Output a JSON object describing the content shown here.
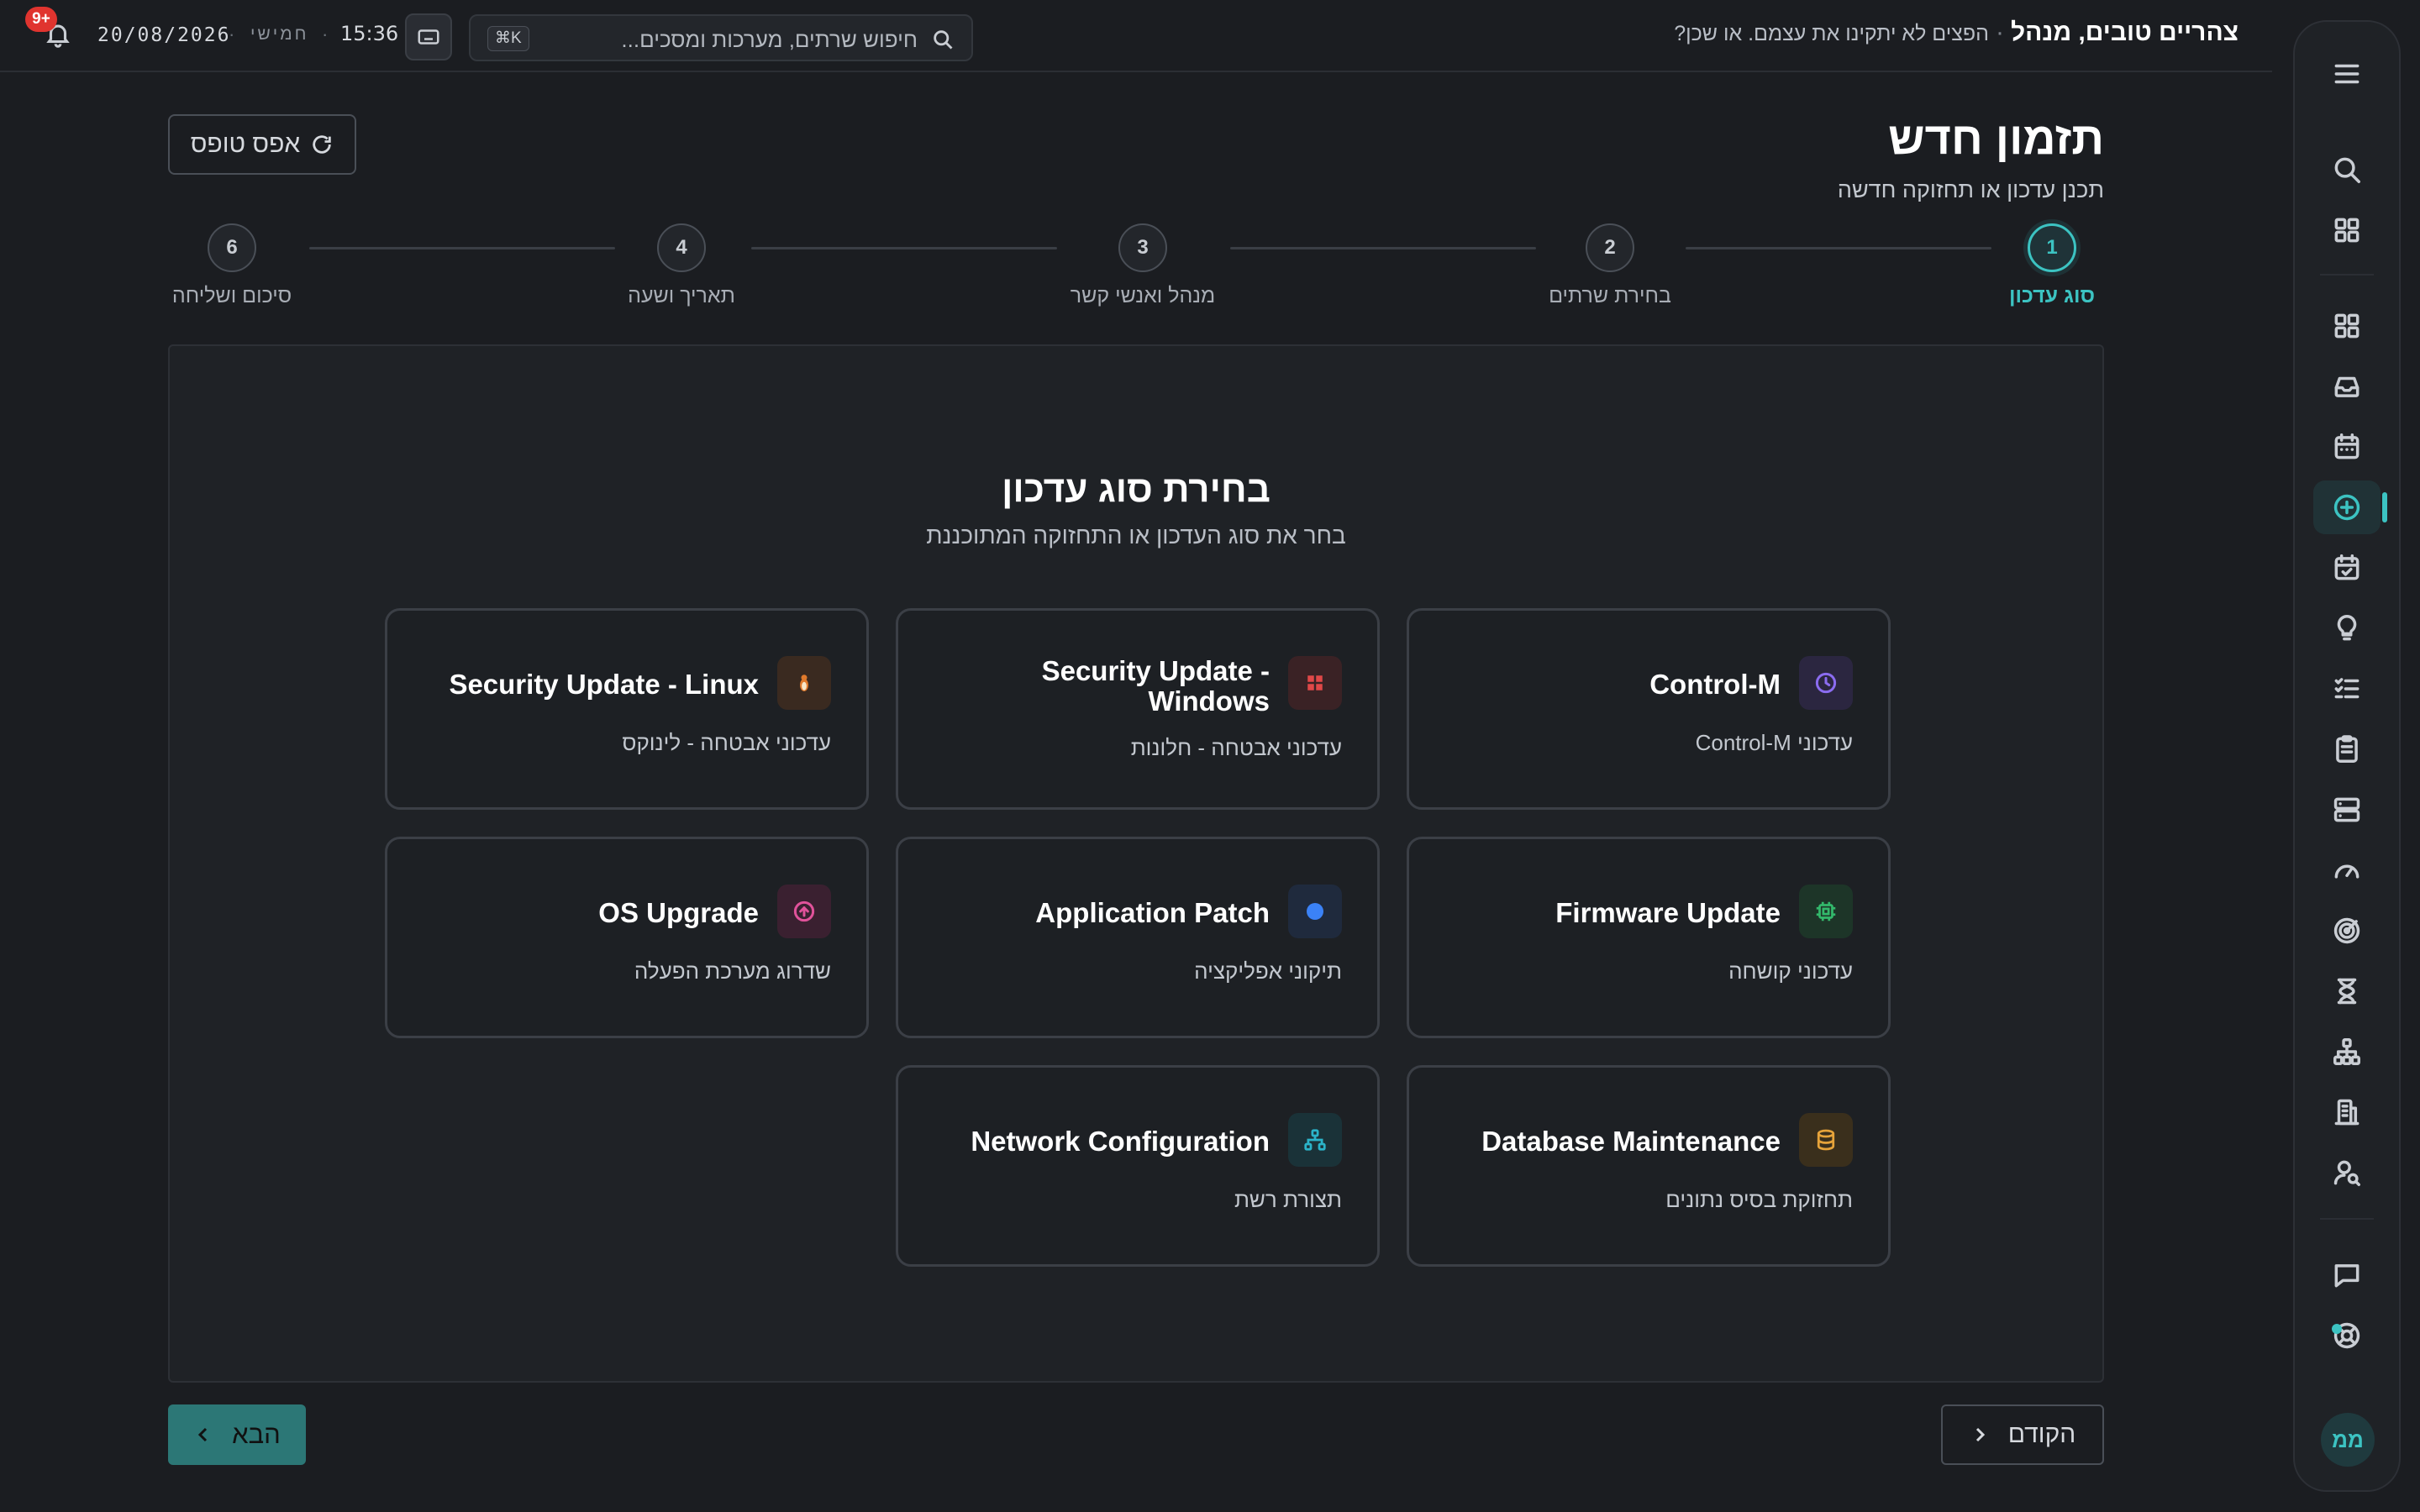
{
  "topbar": {
    "greeting": "צהריים טובים, מנהל",
    "separator": "·",
    "tagline": "הפצים לא יתקינו את עצמם. או שכן?",
    "search_placeholder": "חיפוש שרתים, מערכות ומסכים...",
    "search_shortcut": "⌘K",
    "time": "15:36",
    "weekday": "חמישי",
    "date": "20/08/2026",
    "notifications_badge": "9+"
  },
  "page": {
    "title": "תזמון חדש",
    "subtitle": "תכנן עדכון או תחזוקה חדשה",
    "reset_label": "אפס טופס"
  },
  "stepper": {
    "current_step": 1,
    "steps": [
      {
        "number": "1",
        "label": "סוג עדכון"
      },
      {
        "number": "2",
        "label": "בחירת שרתים"
      },
      {
        "number": "3",
        "label": "מנהל ואנשי קשר"
      },
      {
        "number": "4",
        "label": "תאריך ושעה"
      },
      {
        "number": "6",
        "label": "סיכום ושליחה"
      }
    ]
  },
  "selection": {
    "title": "בחירת סוג עדכון",
    "subtitle": "בחר את סוג העדכון או התחזוקה המתוכננת",
    "options": [
      {
        "title": "Control-M",
        "description": "עדכוני Control-M",
        "icon": "clock-icon",
        "color": "#8b6cf0"
      },
      {
        "title": "Security Update - Windows",
        "description": "עדכוני אבטחה - חלונות",
        "icon": "windows-icon",
        "color": "#e04848"
      },
      {
        "title": "Security Update - Linux",
        "description": "עדכוני אבטחה - לינוקס",
        "icon": "linux-icon",
        "color": "#e07a2c"
      },
      {
        "title": "Firmware Update",
        "description": "עדכוני קושחה",
        "icon": "chip-icon",
        "color": "#33b86b"
      },
      {
        "title": "Application Patch",
        "description": "תיקוני אפליקציה",
        "icon": "dot-icon",
        "color": "#3b82f6"
      },
      {
        "title": "OS Upgrade",
        "description": "שדרוג מערכת הפעלה",
        "icon": "arrow-up-circle-icon",
        "color": "#e0529a"
      },
      {
        "title": "Database Maintenance",
        "description": "תחזוקת בסיס נתונים",
        "icon": "database-icon",
        "color": "#e6a33a"
      },
      {
        "title": "Network Configuration",
        "description": "תצורת רשת",
        "icon": "network-icon",
        "color": "#2bb3c8"
      }
    ]
  },
  "footer": {
    "next_label": "הבא",
    "prev_label": "הקודם"
  },
  "sidebar": {
    "avatar_initials": "ממ",
    "items": [
      "menu-icon",
      "search-icon",
      "apps-icon",
      "dashboard-icon",
      "inbox-icon",
      "calendar-icon",
      "add-circle-icon",
      "calendar-check-icon",
      "lightbulb-icon",
      "checklist-icon",
      "clipboard-icon",
      "server-icon",
      "gauge-icon",
      "radar-icon",
      "hourglass-icon",
      "sitemap-icon",
      "building-icon",
      "user-search-icon",
      "chat-icon",
      "support-icon"
    ]
  },
  "colors": {
    "accent": "#3cc3c2",
    "background": "#1b1d21",
    "badge": "#e0342f",
    "next_button": "#2c7776"
  }
}
